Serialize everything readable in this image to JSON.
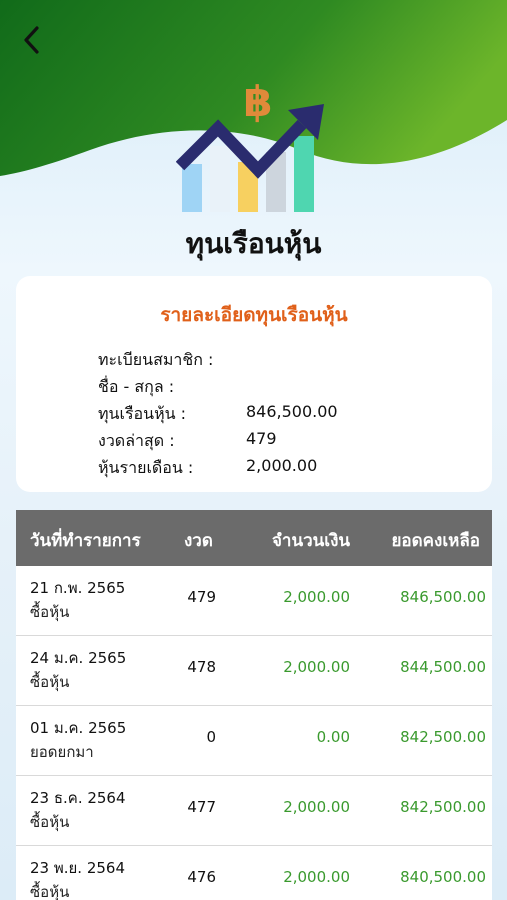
{
  "header": {
    "back_icon": "chevron-left-icon",
    "logo_icon": "bitcoin-rising-chart-icon",
    "title": "ทุนเรือนหุ้น"
  },
  "summary": {
    "title": "รายละเอียดทุนเรือนหุ้น",
    "rows": [
      {
        "label": "ทะเบียนสมาชิก :",
        "value": ""
      },
      {
        "label": "ชื่อ - สกุล :",
        "value": ""
      },
      {
        "label": "ทุนเรือนหุ้น :",
        "value": "846,500.00"
      },
      {
        "label": "งวดล่าสุด :",
        "value": "479"
      },
      {
        "label": "หุ้นรายเดือน :",
        "value": "2,000.00"
      }
    ]
  },
  "table": {
    "columns": [
      "วันที่ทำรายการ",
      "งวด",
      "จำนวนเงิน",
      "ยอดคงเหลือ"
    ],
    "rows": [
      {
        "date": "21 ก.พ. 2565",
        "type": "ซื้อหุ้น",
        "period": "479",
        "amount": "2,000.00",
        "balance": "846,500.00"
      },
      {
        "date": "24 ม.ค. 2565",
        "type": "ซื้อหุ้น",
        "period": "478",
        "amount": "2,000.00",
        "balance": "844,500.00"
      },
      {
        "date": "01 ม.ค. 2565",
        "type": "ยอดยกมา",
        "period": "0",
        "amount": "0.00",
        "balance": "842,500.00"
      },
      {
        "date": "23 ธ.ค. 2564",
        "type": "ซื้อหุ้น",
        "period": "477",
        "amount": "2,000.00",
        "balance": "842,500.00"
      },
      {
        "date": "23 พ.ย. 2564",
        "type": "ซื้อหุ้น",
        "period": "476",
        "amount": "2,000.00",
        "balance": "840,500.00"
      }
    ]
  },
  "colors": {
    "header_green": "#1f7a1f",
    "accent_orange": "#e0601a",
    "amount_green": "#3a9a2e",
    "table_header_gray": "#6b6b6b"
  }
}
